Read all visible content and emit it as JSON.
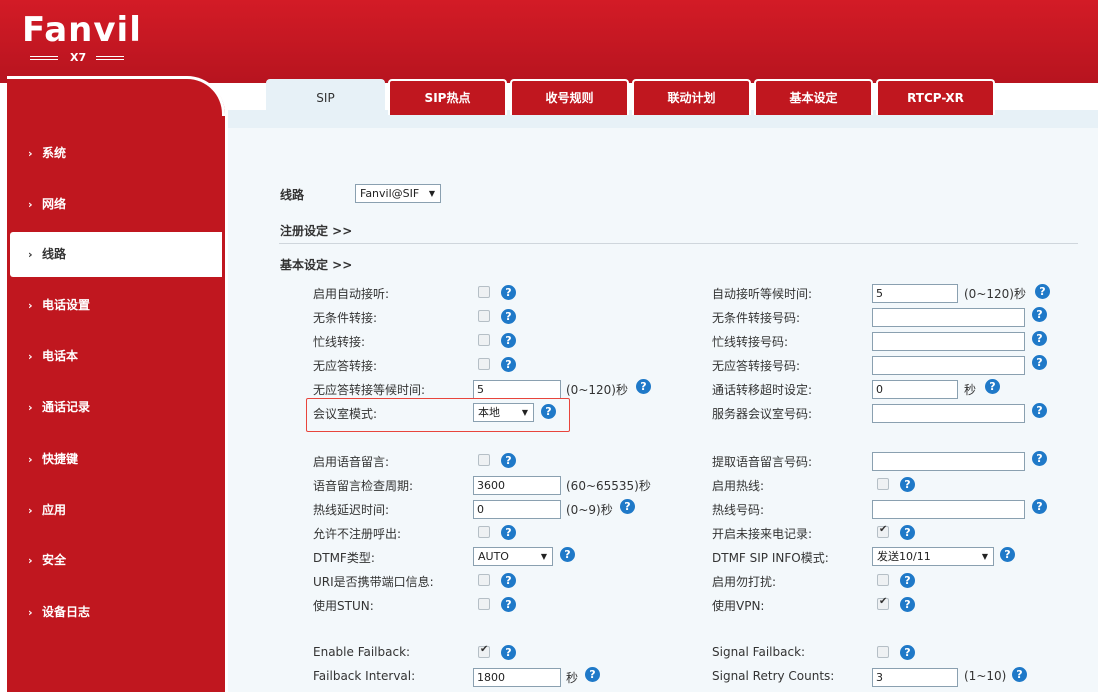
{
  "brand": {
    "name": "Fanvil",
    "model": "X7"
  },
  "sidebar": {
    "items": [
      {
        "label": "系统"
      },
      {
        "label": "网络"
      },
      {
        "label": "线路"
      },
      {
        "label": "电话设置"
      },
      {
        "label": "电话本"
      },
      {
        "label": "通话记录"
      },
      {
        "label": "快捷键"
      },
      {
        "label": "应用"
      },
      {
        "label": "安全"
      },
      {
        "label": "设备日志"
      }
    ],
    "chevron": "›"
  },
  "tabs": [
    {
      "label": "SIP"
    },
    {
      "label": "SIP热点"
    },
    {
      "label": "收号规则"
    },
    {
      "label": "联动计划"
    },
    {
      "label": "基本设定"
    },
    {
      "label": "RTCP-XR"
    }
  ],
  "line": {
    "label": "线路",
    "value": "Fanvil@SIF"
  },
  "sections": {
    "register": "注册设定 >>",
    "basic": "基本设定 >>"
  },
  "form": {
    "auto_answer": "启用自动接听:",
    "auto_answer_time": "自动接听等候时间:",
    "auto_answer_time_value": "5",
    "range_0_120": "(0~120)秒",
    "cfu": "无条件转接:",
    "cfu_number": "无条件转接号码:",
    "cfb": "忙线转接:",
    "cfb_number": "忙线转接号码:",
    "cfnr": "无应答转接:",
    "cfnr_number": "无应答转接号码:",
    "cfnr_time": "无应答转接等候时间:",
    "cfnr_time_value": "5",
    "transfer_timeout": "通话转移超时设定:",
    "transfer_timeout_value": "0",
    "sec_unit": "秒",
    "conf_mode": "会议室模式:",
    "conf_mode_value": "本地",
    "server_conf": "服务器会议室号码:",
    "voicemail": "启用语音留言:",
    "voicemail_number": "提取语音留言号码:",
    "vm_period": "语音留言检查周期:",
    "vm_period_value": "3600",
    "range_60_65535": "(60~65535)秒",
    "hotline": "启用热线:",
    "hotline_delay": "热线延迟时间:",
    "hotline_delay_value": "0",
    "range_0_9": "(0~9)秒",
    "hotline_number": "热线号码:",
    "allow_unreg": "允许不注册呼出:",
    "missed_log": "开启未接来电记录:",
    "dtmf_type": "DTMF类型:",
    "dtmf_type_value": "AUTO",
    "dtmf_sip_info": "DTMF SIP INFO模式:",
    "dtmf_sip_info_value": "发送10/11",
    "uri_port": "URI是否携带端口信息:",
    "dnd": "启用勿打扰:",
    "stun": "使用STUN:",
    "vpn": "使用VPN:",
    "failback": "Enable Failback:",
    "signal_failback": "Signal Failback:",
    "failback_interval": "Failback Interval:",
    "failback_interval_value": "1800",
    "retry_counts": "Signal Retry Counts:",
    "retry_counts_value": "3",
    "range_1_10": "(1~10)"
  },
  "help_glyph": "?",
  "dropdown_glyph": "▼",
  "colors": {
    "brand_red": "#c0171f",
    "help_blue": "#1f79c8",
    "highlight": "#e8453c"
  }
}
